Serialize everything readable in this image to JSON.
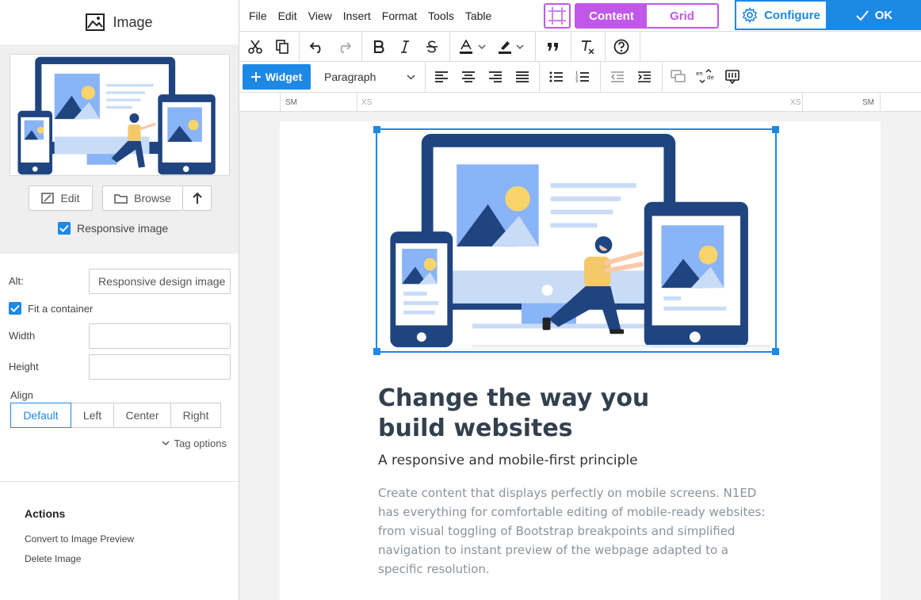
{
  "sidebar": {
    "title": "Image",
    "edit_label": "Edit",
    "browse_label": "Browse",
    "responsive_label": "Responsive image",
    "alt_label": "Alt:",
    "alt_value": "Responsive design image",
    "fit_label": "Fit a container",
    "width_label": "Width",
    "width_value": "",
    "height_label": "Height",
    "height_value": "",
    "align_label": "Align",
    "align_options": [
      "Default",
      "Left",
      "Center",
      "Right"
    ],
    "tag_options_label": "Tag options",
    "actions_title": "Actions",
    "actions": [
      "Convert to Image Preview",
      "Delete Image"
    ]
  },
  "menubar": {
    "items": [
      "File",
      "Edit",
      "View",
      "Insert",
      "Format",
      "Tools",
      "Table"
    ],
    "mode_content": "Content",
    "mode_grid": "Grid",
    "configure_label": "Configure",
    "ok_label": "OK"
  },
  "toolbar": {
    "widget_label": "Widget",
    "paragraph_label": "Paragraph"
  },
  "ruler": {
    "left_sm": "SM",
    "left_xs": "XS",
    "right_xs": "XS",
    "right_sm": "SM"
  },
  "article": {
    "heading": "Change the way you build websites",
    "subheading": "A responsive and mobile-first principle",
    "paragraph": "Create content that displays perfectly on mobile screens. N1ED has everything for comfortable editing of mobile-ready websites: from visual toggling of Bootstrap breakpoints and simplified navigation to instant preview of the webpage adapted to a specific resolution."
  },
  "colors": {
    "accent_blue": "#1e88e5",
    "accent_purple": "#c157e8",
    "illustration_navy": "#1f4480"
  }
}
